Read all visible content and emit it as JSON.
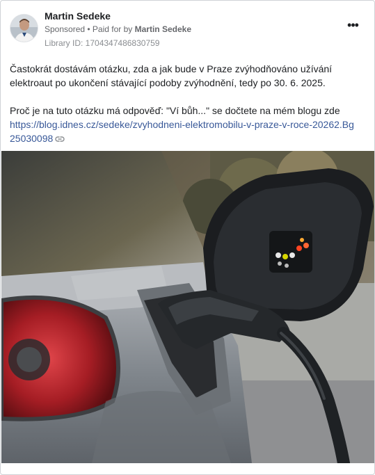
{
  "post": {
    "author": "Martin Sedeke",
    "sponsored_label": "Sponsored",
    "paid_prefix": " • Paid for by ",
    "paid_by": "Martin Sedeke",
    "library_id": "Library ID: 1704347486830759",
    "more_label": "•••",
    "paragraph1": "Častokrát dostávám otázku, zda a jak bude v Praze zvýhodňováno užívání elektroaut po ukončení stávající podoby zvýhodnění, tedy po 30. 6. 2025.",
    "paragraph2": "Proč je na tuto otázku má odpověď: \"Ví bůh...\" se dočtete na mém blogu zde",
    "link_text": "https://blog.idnes.cz/sedeke/zvyhodneni-elektromobilu-v-praze-v-roce-20262.Bg25030098",
    "link_icon": "link-icon"
  },
  "media": {
    "description_icon": "ev-charging-photo",
    "colors": {
      "car_body": "#8c9197",
      "tail_light": "#b8222a",
      "charger": "#1e2124",
      "background": "#6a6350"
    }
  }
}
